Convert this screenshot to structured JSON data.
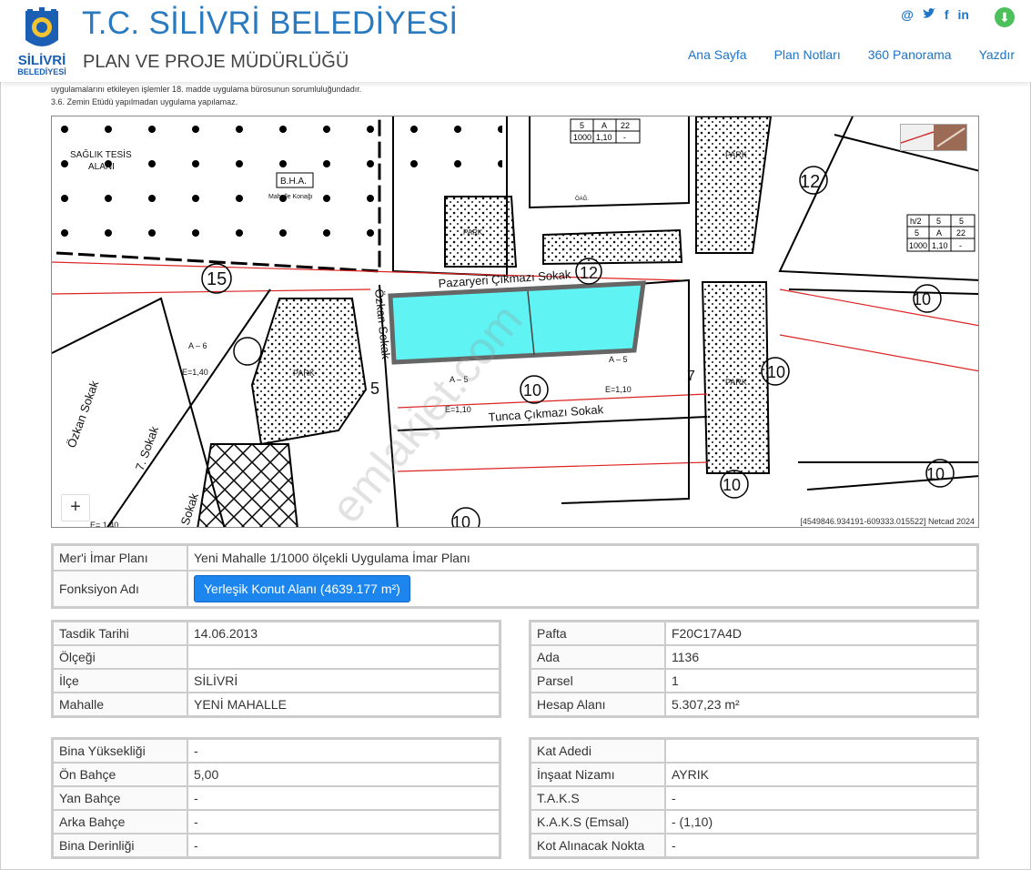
{
  "header": {
    "logo_line1": "SİLİVRİ",
    "logo_line2": "BELEDİYESİ",
    "title": "T.C. SİLİVRİ BELEDİYESİ",
    "subtitle": "PLAN VE PROJE MÜDÜRLÜĞÜ",
    "social_icons": [
      "at-icon",
      "twitter-icon",
      "facebook-icon",
      "linkedin-icon"
    ],
    "nav": [
      "Ana Sayfa",
      "Plan Notları",
      "360 Panorama",
      "Yazdır"
    ],
    "accent_color": "#2a7ac0"
  },
  "notes": {
    "line1": "uygulamalarını etkileyen işlemler 18. madde uygulama bürosunun sorumluluğundadır.",
    "line2": "3.6. Zemin Etüdü yapılmadan uygulama yapılamaz."
  },
  "map": {
    "labels": {
      "saglik": "SAĞLIK TESİS",
      "alani": "ALANI",
      "bha": "B.H.A.",
      "konagi": "Mahalle Konağı",
      "park1": "PARK",
      "park2": "PARK",
      "park3": "PARK",
      "park4": "PARK",
      "pazaryeri": "Pazaryeri Çıkmazı Sokak",
      "tunca": "Tunca Çıkmazı Sokak",
      "ozkan": "Özkan Sokak",
      "ozkan2": "Özkan Sokak",
      "sokak7": "7. Sokak",
      "sokak": "Sokak",
      "n15": "15",
      "n12a": "12",
      "n12b": "12",
      "n10a": "10",
      "n10b": "10",
      "n10c": "10",
      "n10d": "10",
      "n10e": "10",
      "n10f": "10",
      "n5": "5",
      "n7": "7",
      "a5a": "A – 5",
      "a5b": "A – 5",
      "a6": "A – 6",
      "e110a": "E=1,10",
      "e110b": "E=1,10",
      "e140a": "E=1,40",
      "e140b": "E= 1,40",
      "ozel": "ÖAĞ.",
      "watermark": "emlakjet.com"
    },
    "legend_boxes": {
      "h1": "5",
      "h2": "A",
      "h3": "22",
      "h4": "1000",
      "h5": "1,10",
      "h6": "-",
      "r1": "h/2",
      "r2": "5",
      "r3": "5",
      "r4": "5",
      "r5": "A",
      "r6": "22",
      "r7": "1000",
      "r8": "1,10",
      "r9": "-"
    },
    "zoom_label": "+",
    "coords": "[4549846.934191-609333.015522] Netcad 2024"
  },
  "plan": {
    "imar_label": "Mer'i İmar Planı",
    "imar_value": "Yeni Mahalle 1/1000 ölçekli Uygulama İmar Planı",
    "fonksiyon_label": "Fonksiyon Adı",
    "fonksiyon_value": "Yerleşik Konut Alanı (4639.177 m²)"
  },
  "left_table1": [
    {
      "label": "Tasdik Tarihi",
      "value": "14.06.2013"
    },
    {
      "label": "Ölçeği",
      "value": ""
    },
    {
      "label": "İlçe",
      "value": "SİLİVRİ"
    },
    {
      "label": "Mahalle",
      "value": "YENİ MAHALLE"
    }
  ],
  "right_table1": [
    {
      "label": "Pafta",
      "value": "F20C17A4D"
    },
    {
      "label": "Ada",
      "value": "1136"
    },
    {
      "label": "Parsel",
      "value": "1"
    },
    {
      "label": "Hesap Alanı",
      "value": "5.307,23 m²"
    }
  ],
  "left_table2": [
    {
      "label": "Bina Yüksekliği",
      "value": "-"
    },
    {
      "label": "Ön Bahçe",
      "value": "5,00"
    },
    {
      "label": "Yan Bahçe",
      "value": "-"
    },
    {
      "label": "Arka Bahçe",
      "value": "-"
    },
    {
      "label": "Bina Derinliği",
      "value": "-"
    }
  ],
  "right_table2": [
    {
      "label": "Kat Adedi",
      "value": ""
    },
    {
      "label": "İnşaat Nizamı",
      "value": "AYRIK"
    },
    {
      "label": "T.A.K.S",
      "value": "-"
    },
    {
      "label": "K.A.K.S (Emsal)",
      "value": "- (1,10)"
    },
    {
      "label": "Kot Alınacak Nokta",
      "value": "-"
    }
  ]
}
